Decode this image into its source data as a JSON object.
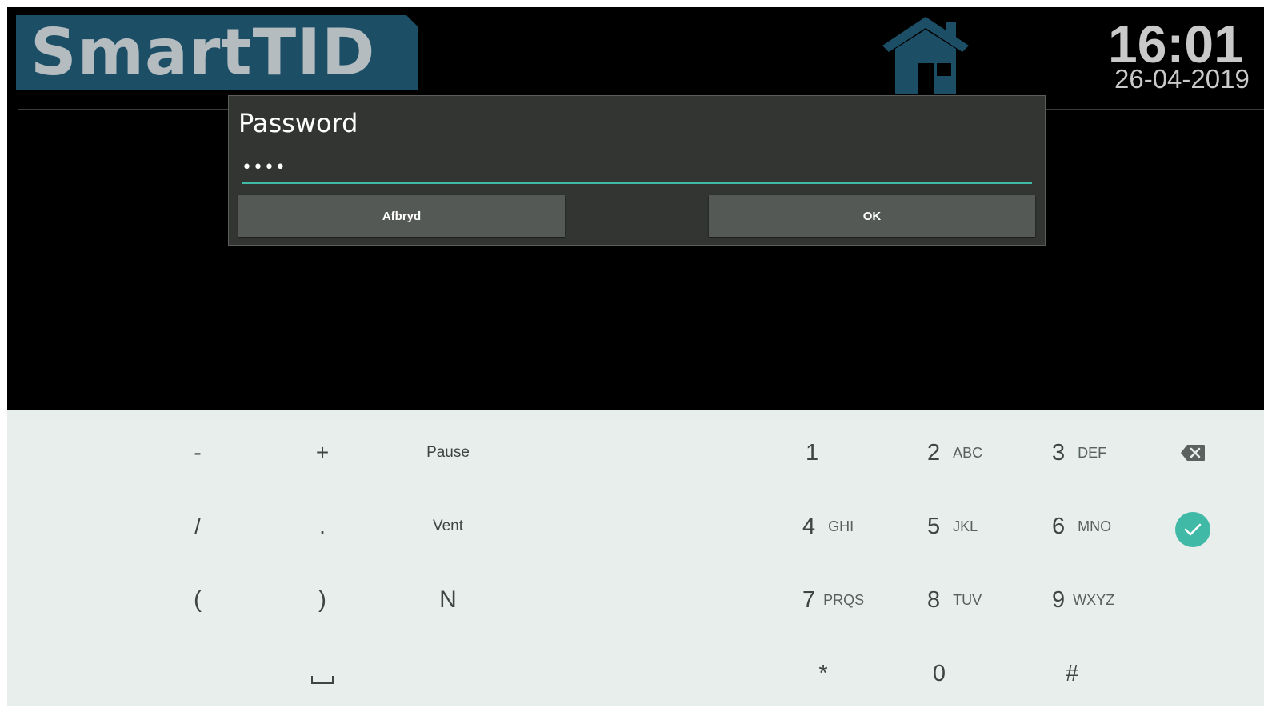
{
  "header": {
    "logo_text": "SmartTID",
    "time": "16:01",
    "date": "26-04-2019"
  },
  "dialog": {
    "title": "Password",
    "password_value": "••••",
    "cancel_label": "Afbryd",
    "ok_label": "OK"
  },
  "keyboard": {
    "symbols": {
      "minus": "-",
      "plus": "+",
      "pause": "Pause",
      "slash": "/",
      "period": ".",
      "wait": "Vent",
      "paren_open": "(",
      "paren_close": ")",
      "n": "N"
    },
    "digits": [
      {
        "num": "1",
        "letters": ""
      },
      {
        "num": "2",
        "letters": "ABC"
      },
      {
        "num": "3",
        "letters": "DEF"
      },
      {
        "num": "4",
        "letters": "GHI"
      },
      {
        "num": "5",
        "letters": "JKL"
      },
      {
        "num": "6",
        "letters": "MNO"
      },
      {
        "num": "7",
        "letters": "PRQS"
      },
      {
        "num": "8",
        "letters": "TUV"
      },
      {
        "num": "9",
        "letters": "WXYZ"
      }
    ],
    "star": "*",
    "zero": "0",
    "hash": "#",
    "icons": {
      "backspace": "backspace-icon",
      "done": "checkmark-icon",
      "space": "space-bar-icon",
      "home": "home-icon"
    },
    "colors": {
      "accent": "#40b9a6",
      "keyboard_bg": "#e8eeeb",
      "logo_bg": "#1c4e66"
    }
  }
}
